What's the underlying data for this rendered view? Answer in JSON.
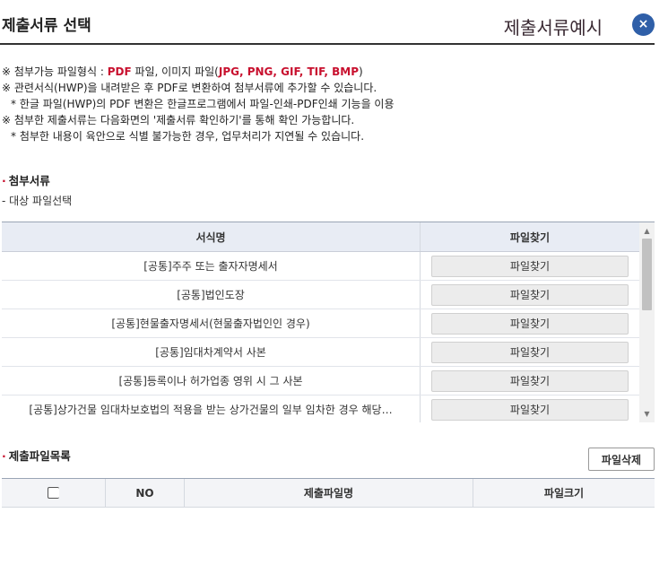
{
  "header": {
    "title": "제출서류 선택",
    "example": "제출서류예시",
    "close_glyph": "×"
  },
  "notes": [
    {
      "prefix": "※ 첨부가능 파일형식 : ",
      "pdf": "PDF",
      "mid": " 파일, 이미지 파일(",
      "images": "JPG, PNG, GIF, TIF, BMP",
      "suffix": ")"
    },
    {
      "text": "※ 관련서식(HWP)을 내려받은 후 PDF로 변환하여 첨부서류에 추가할 수 있습니다."
    },
    {
      "text": "* 한글 파일(HWP)의 PDF 변환은 한글프로그램에서 파일-인쇄-PDF인쇄 기능을 이용"
    },
    {
      "text": "※ 첨부한 제출서류는 다음화면의 '제출서류 확인하기'를 통해 확인 가능합니다."
    },
    {
      "text": "* 첨부한 내용이 육안으로 식별 불가능한 경우, 업무처리가 지연될 수 있습니다."
    }
  ],
  "attach": {
    "label": "첨부서류",
    "sub_label": "- 대상 파일선택",
    "columns": {
      "name": "서식명",
      "find": "파일찾기"
    },
    "rows": [
      {
        "name": "[공통]주주 또는 출자자명세서",
        "button": "파일찾기"
      },
      {
        "name": "[공통]법인도장",
        "button": "파일찾기"
      },
      {
        "name": "[공통]현물출자명세서(현물출자법인인 경우)",
        "button": "파일찾기"
      },
      {
        "name": "[공통]임대차계약서 사본",
        "button": "파일찾기"
      },
      {
        "name": "[공통]등록이나 허가업종 영위 시 그 사본",
        "button": "파일찾기"
      },
      {
        "name": "[공통]상가건물 임대차보호법의 적용을 받는 상가건물의 일부 임차한 경우 해당…",
        "button": "파일찾기"
      }
    ]
  },
  "submit": {
    "label": "제출파일목록",
    "delete_button": "파일삭제",
    "columns": {
      "no": "NO",
      "file_name": "제출파일명",
      "file_size": "파일크기"
    }
  },
  "colors": {
    "accent_red": "#c8102e",
    "close_blue": "#2f5fa8"
  }
}
